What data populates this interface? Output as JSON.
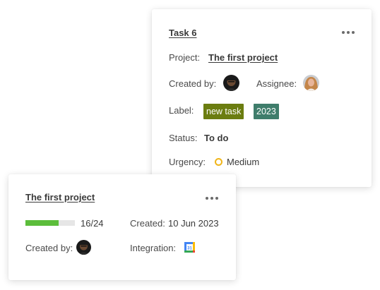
{
  "task_card": {
    "title": "Task 6",
    "project_label": "Project:",
    "project_value": "The first project",
    "created_by_label": "Created by:",
    "assignee_label": "Assignee:",
    "label_label": "Label:",
    "tags": [
      {
        "text": "new task",
        "color": "#6b7d10"
      },
      {
        "text": "2023",
        "color": "#3f7d6b"
      }
    ],
    "status_label": "Status:",
    "status_value": "To do",
    "urgency_label": "Urgency:",
    "urgency_value": "Medium",
    "urgency_color": "#f0b51a",
    "more_icon": "more-horizontal-icon"
  },
  "project_card": {
    "title": "The first project",
    "progress_text": "16/24",
    "progress_fraction": 0.6667,
    "progress_color": "#5cbd3b",
    "created_label": "Created:",
    "created_value": "10 Jun 2023",
    "created_by_label": "Created by:",
    "integration_label": "Integration:",
    "integration_icon": "google-calendar-icon",
    "more_icon": "more-horizontal-icon"
  }
}
